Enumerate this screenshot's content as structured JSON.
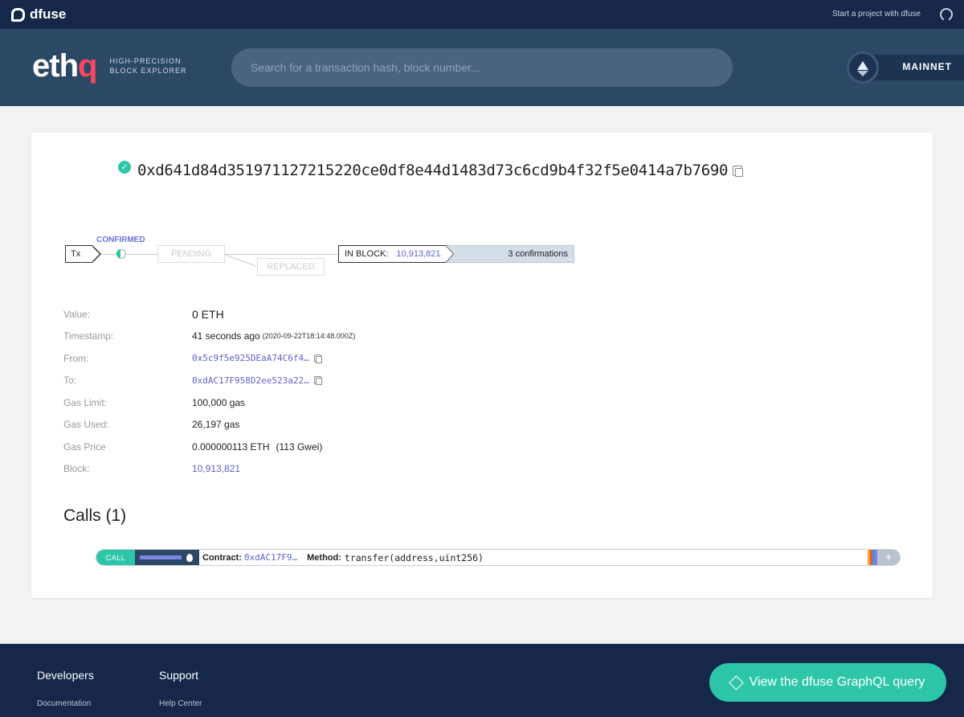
{
  "topbar": {
    "brand": "dfuse",
    "start_link": "Start a project with dfuse"
  },
  "header": {
    "logo_main": "eth",
    "logo_accent": "q",
    "tagline_line1": "HIGH-PRECISION",
    "tagline_line2": "BLOCK EXPLORER",
    "search_placeholder": "Search for a transaction hash, block number...",
    "network": "MAINNET"
  },
  "transaction": {
    "hash": "0xd641d84d351971127215220ce0df8e44d1483d73c6cd9b4f32f5e0414a7b7690",
    "status_flow": {
      "tx_label": "Tx",
      "confirmed_label": "CONFIRMED",
      "pending_label": "PENDING",
      "replaced_label": "REPLACED",
      "in_block_label": "IN BLOCK:",
      "block_number": "10,913,821",
      "confirmations": "3 confirmations"
    },
    "details": {
      "value_label": "Value:",
      "value": "0 ETH",
      "timestamp_label": "Timestamp:",
      "timestamp": "41 seconds ago",
      "timestamp_exact": "(2020-09-22T18:14:48.000Z)",
      "from_label": "From:",
      "from": "0x5c9f5e925DEaA74C6f4…",
      "to_label": "To:",
      "to": "0xdAC17F958D2ee523a22…",
      "gas_limit_label": "Gas Limit:",
      "gas_limit": "100,000 gas",
      "gas_used_label": "Gas Used:",
      "gas_used": "26,197 gas",
      "gas_price_label": "Gas Price",
      "gas_price": "0.000000113 ETH",
      "gas_price_gwei": "(113 Gwei)",
      "block_label": "Block:",
      "block": "10,913,821"
    }
  },
  "calls": {
    "title": "Calls (1)",
    "items": [
      {
        "type": "CALL",
        "contract_label": "Contract:",
        "contract": "0xdAC17F9…",
        "method_label": "Method:",
        "method": "transfer(address,uint256)",
        "gas_used_fraction": 0.26,
        "expand": "+"
      }
    ]
  },
  "footer": {
    "col1_head": "Developers",
    "col1_link": "Documentation",
    "col2_head": "Support",
    "col2_link": "Help Center",
    "graphql_button": "View the dfuse GraphQL query"
  },
  "colors": {
    "accent": "#2dc6a8",
    "link": "#5a65c8",
    "navy": "#15284a",
    "header": "#2b4865",
    "logo_accent": "#ff4660"
  }
}
